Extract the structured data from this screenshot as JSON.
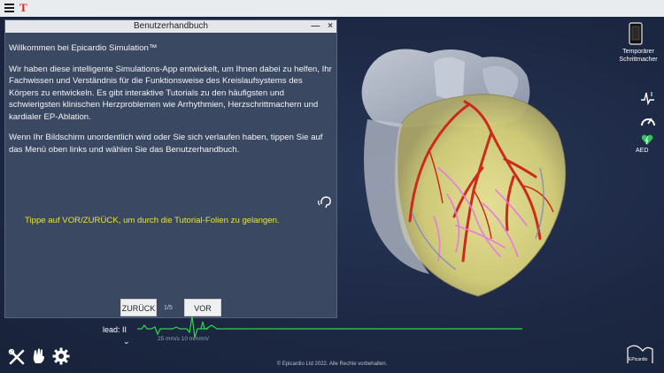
{
  "topbar": {
    "logo_letter": "T"
  },
  "manual": {
    "title": "Benutzerhandbuch",
    "minimize_glyph": "—",
    "close_glyph": "×",
    "heading": "Willkommen bei Epicardio Simulation™",
    "paragraph1": "Wir haben diese intelligente Simulations-App entwickelt, um Ihnen dabei zu helfen, Ihr Fachwissen und Verständnis für die Funktionsweise des Kreislaufsystems des Körpers zu entwickeln.  Es gibt interaktive Tutorials zu den häufigsten und schwierigsten klinischen Herzproblemen wie Arrhythmien, Herzschrittmachern und kardialer EP-Ablation.",
    "paragraph2": "Wenn Ihr Bildschirm unordentlich wird oder Sie sich verlaufen haben, tippen Sie auf das Menü oben links und wählen Sie das Benutzerhandbuch.",
    "hint": "Tippe auf VOR/ZURÜCK, um durch die Tutorial-Folien zu gelangen.",
    "prev_label": "ZURÜCK",
    "next_label": "VOR",
    "page_indicator": "1/5"
  },
  "ecg": {
    "lead_label": "lead: II",
    "scale_text": "25 mm/s   10 mm/mV",
    "trace_color": "#2fd64a"
  },
  "right_panel": {
    "pacer_label": "Temporärer Schrittmacher",
    "aed_label": "AED"
  },
  "icons": {
    "menu": "menu-icon",
    "sound": "sound-icon",
    "tools": "tools-icon",
    "hand": "hand-icon",
    "settings": "gear-icon",
    "pacer": "pacemaker-icon",
    "ecg_wave": "ecg-wave-icon",
    "gauge": "gauge-icon",
    "aed": "aed-icon"
  },
  "footer": {
    "copyright": "© Epicardio Ltd 2022. Alle Rechte vorbehalten.",
    "logo_text": "EPicardio"
  },
  "colors": {
    "background": "#1f2a44",
    "panel": "#3b4862",
    "hint": "#e8e436",
    "accent_red": "#e0241b"
  }
}
